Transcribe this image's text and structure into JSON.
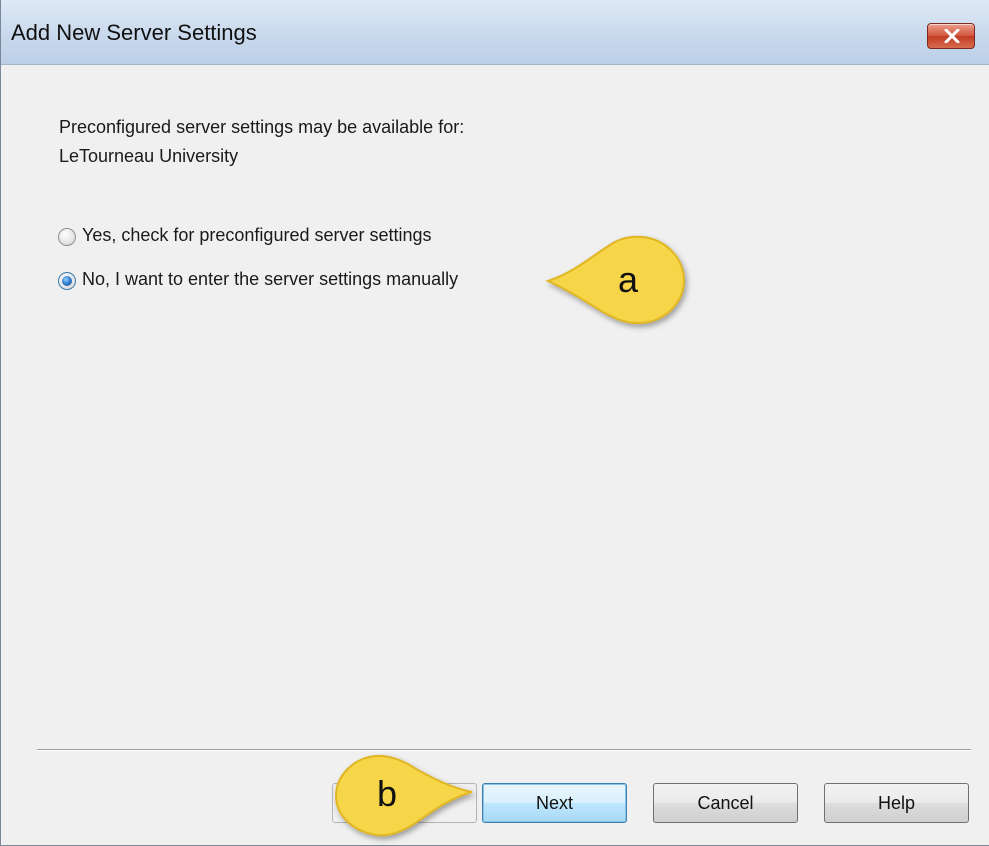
{
  "window": {
    "title": "Add New Server Settings",
    "close_label": "close"
  },
  "content": {
    "intro_line1": "Preconfigured server settings may be available for:",
    "intro_line2": "LeTourneau University"
  },
  "options": [
    {
      "label": "Yes, check for preconfigured server settings",
      "selected": false
    },
    {
      "label": "No, I want to enter the server settings manually",
      "selected": true
    }
  ],
  "buttons": {
    "next": "Next",
    "cancel": "Cancel",
    "help": "Help"
  },
  "callouts": {
    "a": "a",
    "b": "b",
    "fill": "#f7d54a",
    "stroke": "#e0b623"
  }
}
